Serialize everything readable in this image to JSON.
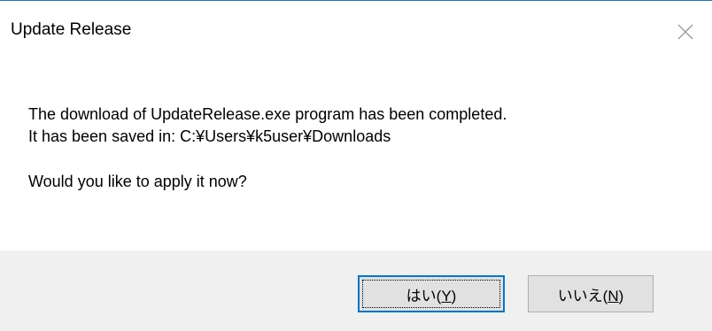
{
  "dialog": {
    "title": "Update Release",
    "close_icon": "close-icon",
    "message_lines": [
      "The download of UpdateRelease.exe program has been completed.",
      "It has been saved in: C:¥Users¥k5user¥Downloads"
    ],
    "question": "Would you like to apply it now?"
  },
  "buttons": {
    "yes_label": "はい(",
    "yes_accel": "Y",
    "yes_suffix": ")",
    "no_label": "いいえ(",
    "no_accel": "N",
    "no_suffix": ")"
  },
  "colors": {
    "accent": "#0078d7",
    "title_border": "#1e73c8",
    "button_bar": "#f0f0f0",
    "button_face": "#e1e1e1"
  }
}
